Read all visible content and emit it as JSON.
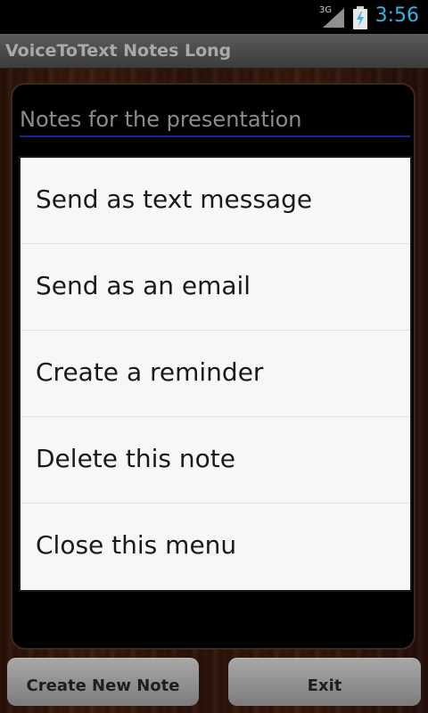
{
  "status_bar": {
    "network": "3G",
    "clock": "3:56",
    "signal_icon": "signal-icon",
    "battery_icon": "battery-charging-icon",
    "clock_color": "#33b5e5"
  },
  "app": {
    "title": "VoiceToText Notes Long"
  },
  "note": {
    "title": "Notes for the presentation"
  },
  "menu": {
    "items": [
      {
        "label": "Send as text message"
      },
      {
        "label": "Send as an email"
      },
      {
        "label": "Create a reminder"
      },
      {
        "label": "Delete this note"
      },
      {
        "label": "Close this menu"
      }
    ]
  },
  "buttons": {
    "create_new_note": "Create New Note",
    "exit": "Exit"
  }
}
